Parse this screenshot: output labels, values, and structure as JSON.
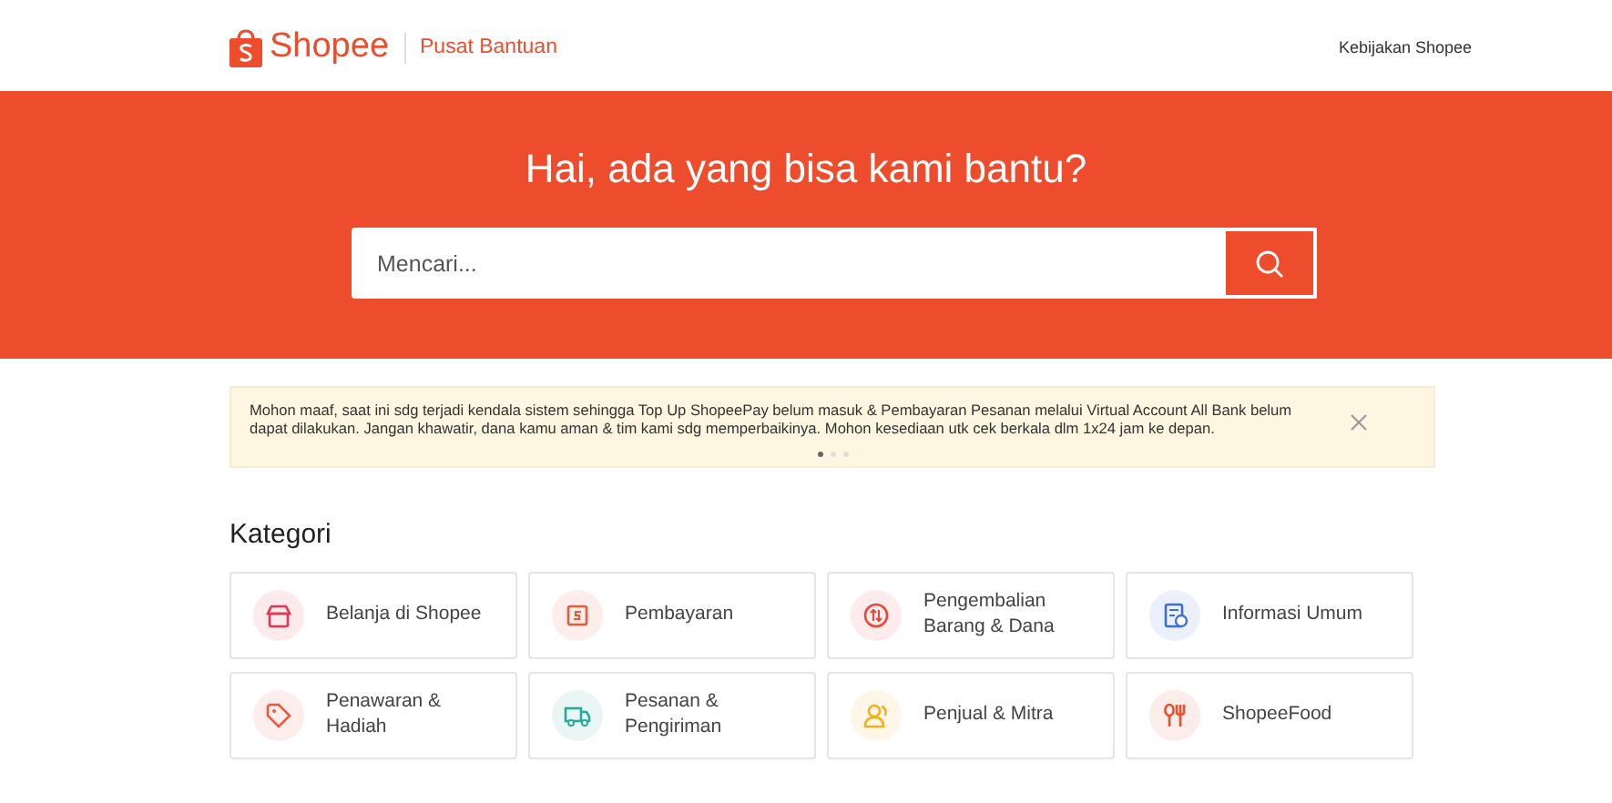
{
  "header": {
    "logo_text": "Shopee",
    "subtitle": "Pusat Bantuan",
    "link": "Kebijakan Shopee"
  },
  "hero": {
    "title": "Hai, ada yang bisa kami bantu?",
    "search": {
      "placeholder": "Mencari..."
    }
  },
  "notice": {
    "text": "Mohon maaf, saat ini sdg terjadi kendala sistem sehingga Top Up ShopeePay belum masuk & Pembayaran Pesanan melalui Virtual Account All Bank belum dapat dilakukan. Jangan khawatir, dana kamu aman & tim kami sdg memperbaikinya. Mohon kesediaan utk cek berkala dlm 1x24 jam ke depan.",
    "dots": [
      {
        "selected": true
      },
      {
        "selected": false
      },
      {
        "selected": false
      }
    ]
  },
  "categories": {
    "title": "Kategori",
    "items": [
      {
        "label": "Belanja di Shopee",
        "kind": "store",
        "color": "#e8344e"
      },
      {
        "label": "Pembayaran",
        "kind": "payment",
        "color": "#ee5a36"
      },
      {
        "label": "Pengembalian Barang & Dana",
        "kind": "refund",
        "color": "#e8483a"
      },
      {
        "label": "Informasi Umum",
        "kind": "info",
        "color": "#3d6fd8"
      },
      {
        "label": "Penawaran & Hadiah",
        "kind": "tag",
        "color": "#f0583e"
      },
      {
        "label": "Pesanan & Pengiriman",
        "kind": "truck",
        "color": "#26aa99"
      },
      {
        "label": "Penjual & Mitra",
        "kind": "partner",
        "color": "#f2b11e"
      },
      {
        "label": "ShopeeFood",
        "kind": "food",
        "color": "#ee4d2d"
      }
    ]
  }
}
